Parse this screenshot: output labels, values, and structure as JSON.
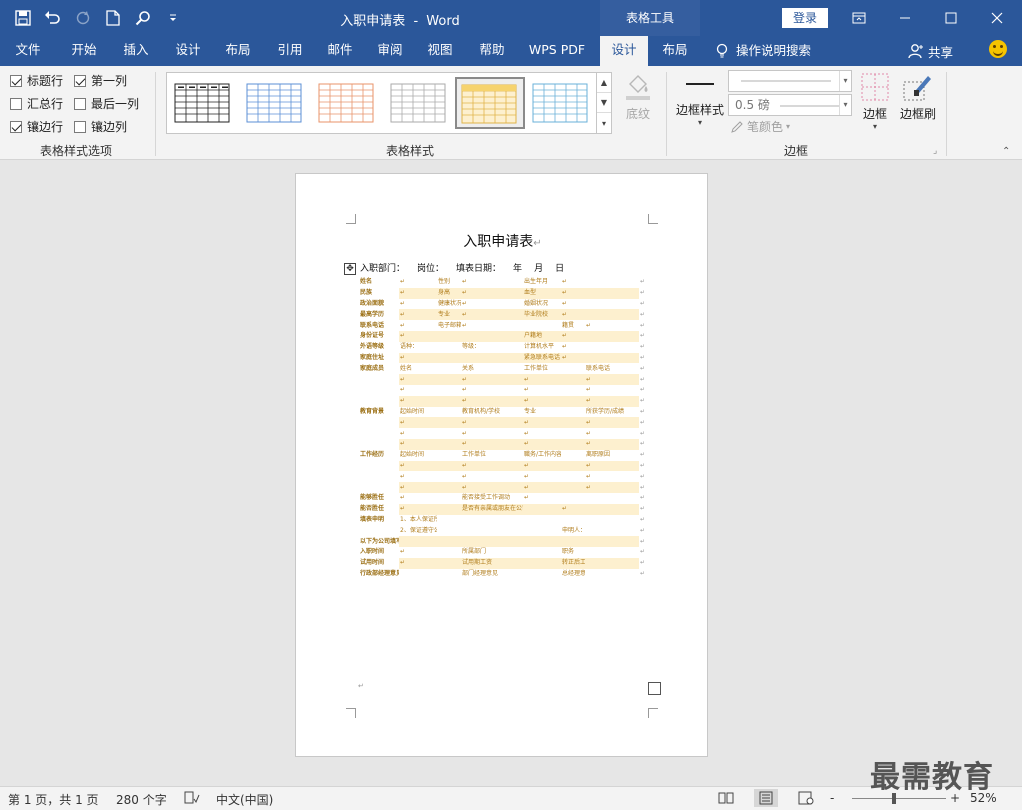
{
  "titlebar": {
    "doc_name": "入职申请表",
    "separator": "-",
    "app_name": "Word",
    "context_tab": "表格工具",
    "login": "登录"
  },
  "tabs": [
    "文件",
    "开始",
    "插入",
    "设计",
    "布局",
    "引用",
    "邮件",
    "审阅",
    "视图",
    "帮助",
    "WPS PDF",
    "设计",
    "布局"
  ],
  "active_tab_index": 11,
  "tell_me": "操作说明搜索",
  "share": "共享",
  "ribbon": {
    "style_options": {
      "label": "表格样式选项",
      "items": [
        {
          "text": "标题行",
          "checked": true
        },
        {
          "text": "第一列",
          "checked": true
        },
        {
          "text": "汇总行",
          "checked": false
        },
        {
          "text": "最后一列",
          "checked": false
        },
        {
          "text": "镶边行",
          "checked": true
        },
        {
          "text": "镶边列",
          "checked": false
        }
      ]
    },
    "table_styles": {
      "label": "表格样式"
    },
    "shading": "底纹",
    "borders_group": {
      "label": "边框",
      "border_style": "边框样式",
      "weight": "0.5 磅",
      "pen_color": "笔颜色",
      "borders": "边框",
      "border_painter": "边框刷"
    }
  },
  "document": {
    "title": "入职申请表",
    "header": [
      "入职部门：",
      "岗位：",
      "填表日期：",
      "年",
      "月",
      "日"
    ],
    "para_mark": "↵",
    "rows": [
      {
        "band": false,
        "cells": [
          "姓名",
          "↵",
          "性别",
          "↵",
          "出生年月",
          "↵",
          "",
          "↵"
        ]
      },
      {
        "band": true,
        "cells": [
          "民族",
          "↵",
          "身高",
          "↵",
          "血型",
          "↵",
          "",
          "↵"
        ]
      },
      {
        "band": false,
        "cells": [
          "政治面貌",
          "↵",
          "健康状况",
          "↵",
          "婚姻状况",
          "↵",
          "",
          "↵"
        ]
      },
      {
        "band": true,
        "cells": [
          "最高学历",
          "↵",
          "专业",
          "↵",
          "毕业院校",
          "↵",
          "",
          "↵"
        ]
      },
      {
        "band": false,
        "cells": [
          "联系电话",
          "↵",
          "电子邮箱",
          "↵",
          "",
          "籍贯",
          "↵",
          "↵"
        ]
      },
      {
        "band": true,
        "cells": [
          "身份证号",
          "↵",
          "",
          "",
          "户籍地",
          "↵",
          "",
          "↵"
        ]
      },
      {
        "band": false,
        "cells": [
          "外语等级",
          "语种：",
          "",
          "等级：",
          "计算机水平",
          "↵",
          "",
          "↵"
        ]
      },
      {
        "band": true,
        "cells": [
          "家庭住址",
          "↵",
          "",
          "",
          "紧急联系电话",
          "↵",
          "",
          "↵"
        ]
      },
      {
        "band": false,
        "cells": [
          "家庭成员",
          "姓名",
          "",
          "关系",
          "工作单位",
          "",
          "联系电话",
          "↵"
        ]
      },
      {
        "band": true,
        "cells": [
          "",
          "↵",
          "",
          "↵",
          "↵",
          "",
          "↵",
          "↵"
        ]
      },
      {
        "band": false,
        "cells": [
          "",
          "↵",
          "",
          "↵",
          "↵",
          "",
          "↵",
          "↵"
        ]
      },
      {
        "band": true,
        "cells": [
          "",
          "↵",
          "",
          "↵",
          "↵",
          "",
          "↵",
          "↵"
        ]
      },
      {
        "band": false,
        "cells": [
          "教育背景",
          "起始时间",
          "",
          "教育机构/学校",
          "专业",
          "",
          "所获学历/成绩",
          "↵"
        ]
      },
      {
        "band": true,
        "cells": [
          "",
          "↵",
          "",
          "↵",
          "↵",
          "",
          "↵",
          "↵"
        ]
      },
      {
        "band": false,
        "cells": [
          "",
          "↵",
          "",
          "↵",
          "↵",
          "",
          "↵",
          "↵"
        ]
      },
      {
        "band": true,
        "cells": [
          "",
          "↵",
          "",
          "↵",
          "↵",
          "",
          "↵",
          "↵"
        ]
      },
      {
        "band": false,
        "cells": [
          "工作经历",
          "起始时间",
          "",
          "工作单位",
          "職务/工作内容",
          "",
          "离职原因",
          "↵"
        ]
      },
      {
        "band": true,
        "cells": [
          "",
          "↵",
          "",
          "↵",
          "↵",
          "",
          "↵",
          "↵"
        ]
      },
      {
        "band": false,
        "cells": [
          "",
          "↵",
          "",
          "↵",
          "↵",
          "",
          "↵",
          "↵"
        ]
      },
      {
        "band": true,
        "cells": [
          "",
          "↵",
          "",
          "↵",
          "↵",
          "",
          "↵",
          "↵"
        ]
      },
      {
        "band": false,
        "cells": [
          "能够胜任",
          "↵",
          "",
          "能否接受工作调动",
          "↵",
          "",
          "",
          "↵"
        ]
      },
      {
        "band": true,
        "cells": [
          "能否胜任",
          "↵",
          "",
          "是否有亲属或朋友在公司（姓名）",
          "",
          "↵",
          "",
          "↵"
        ]
      },
      {
        "band": false,
        "cells": [
          "填表申明",
          "1、本人保证所填写的材料属实",
          "",
          "",
          "",
          "",
          "",
          "↵"
        ]
      },
      {
        "band": false,
        "cells": [
          "",
          "2、保证遵守公司各项管理制度",
          "",
          "",
          "",
          "申明人：",
          "",
          "↵"
        ]
      },
      {
        "band": true,
        "cells": [
          "以下为公司填写",
          "",
          "",
          "",
          "",
          "",
          "",
          "↵"
        ]
      },
      {
        "band": false,
        "cells": [
          "入职时间",
          "↵",
          "",
          "所属部门",
          "",
          "职务",
          "",
          "↵"
        ]
      },
      {
        "band": true,
        "cells": [
          "试用时间",
          "↵",
          "",
          "试用期工资",
          "",
          "转正后工资",
          "",
          "↵"
        ]
      },
      {
        "band": false,
        "cells": [
          "行政部经理意见：",
          "",
          "",
          "部门经理意见",
          "",
          "总经理意见",
          "",
          "↵"
        ]
      }
    ]
  },
  "statusbar": {
    "page": "第 1 页，共 1 页",
    "words": "280 个字",
    "language": "中文(中国)",
    "zoom_minus": "-",
    "zoom_plus": "+",
    "zoom": "52%"
  },
  "watermark": "最需教育",
  "colors": {
    "word_blue": "#2b579a",
    "band": "#fdf0cf",
    "label_text": "#9b6f14"
  }
}
